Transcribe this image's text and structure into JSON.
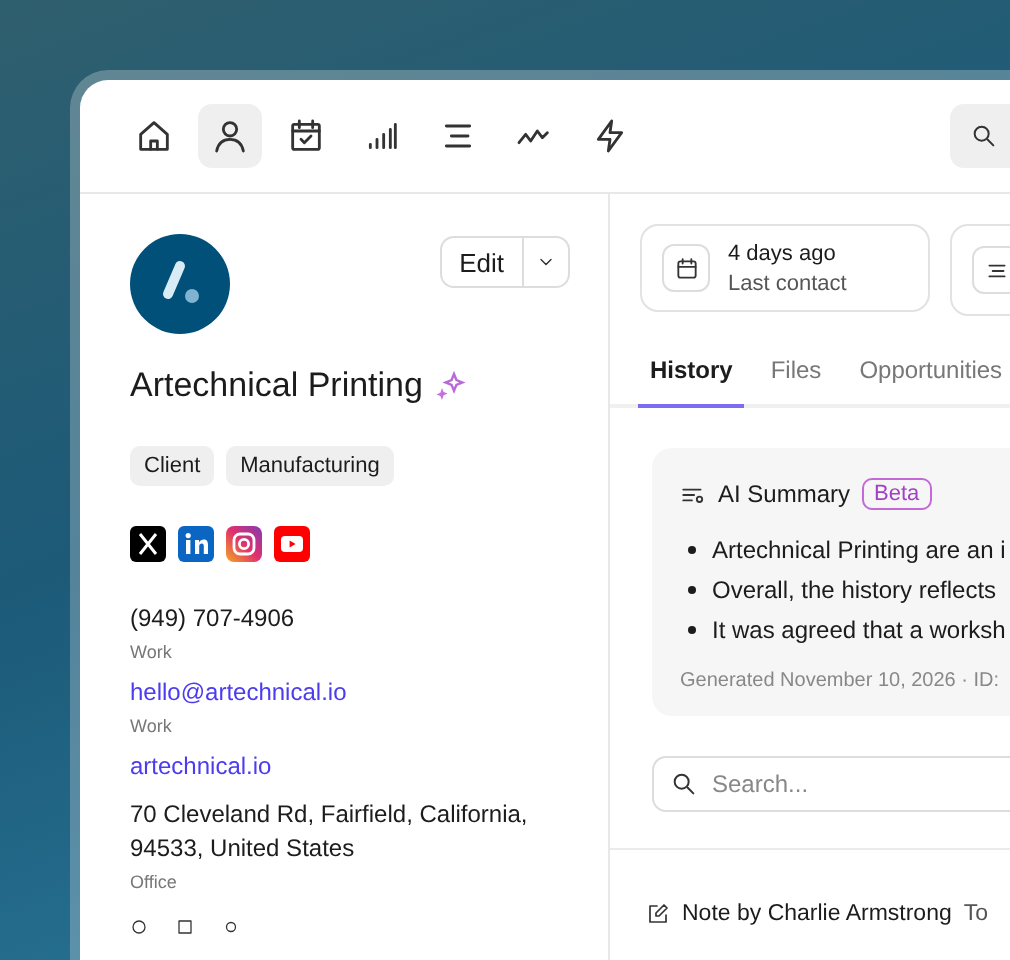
{
  "nav": {
    "items": [
      {
        "kind": "home",
        "selected": false
      },
      {
        "kind": "person",
        "selected": true
      },
      {
        "kind": "calendar",
        "selected": false
      },
      {
        "kind": "signal",
        "selected": false
      },
      {
        "kind": "list",
        "selected": false
      },
      {
        "kind": "trend",
        "selected": false
      },
      {
        "kind": "bolt",
        "selected": false
      }
    ]
  },
  "profile": {
    "edit_button": "Edit",
    "name": "Artechnical Printing",
    "tags": [
      "Client",
      "Manufacturing"
    ],
    "socials": [
      {
        "kind": "x"
      },
      {
        "kind": "linkedin"
      },
      {
        "kind": "instagram"
      },
      {
        "kind": "youtube"
      }
    ],
    "contacts": [
      {
        "kind": "text",
        "value": "(949) 707-4906",
        "label": "Work"
      },
      {
        "kind": "link",
        "value": "hello@artechnical.io",
        "label": "Work"
      },
      {
        "kind": "link",
        "value": "artechnical.io"
      },
      {
        "kind": "text",
        "value": "70 Cleveland Rd, Fairfield, California, 94533, United States",
        "label": "Office"
      }
    ]
  },
  "stats": [
    {
      "value": "4 days ago",
      "label": "Last contact"
    }
  ],
  "tabs": [
    {
      "label": "History",
      "selected": true
    },
    {
      "label": "Files",
      "selected": false
    },
    {
      "label": "Opportunities",
      "selected": false
    }
  ],
  "summary": {
    "title": "AI Summary",
    "badge": "Beta",
    "bullets": [
      "Artechnical Printing are an i",
      "Overall, the history reflects",
      "It was agreed that a worksh"
    ],
    "footer": "Generated November 10, 2026 · ID:"
  },
  "search": {
    "placeholder": "Search..."
  },
  "history": [
    {
      "title": "Note by Charlie Armstrong",
      "extra": "To"
    }
  ]
}
